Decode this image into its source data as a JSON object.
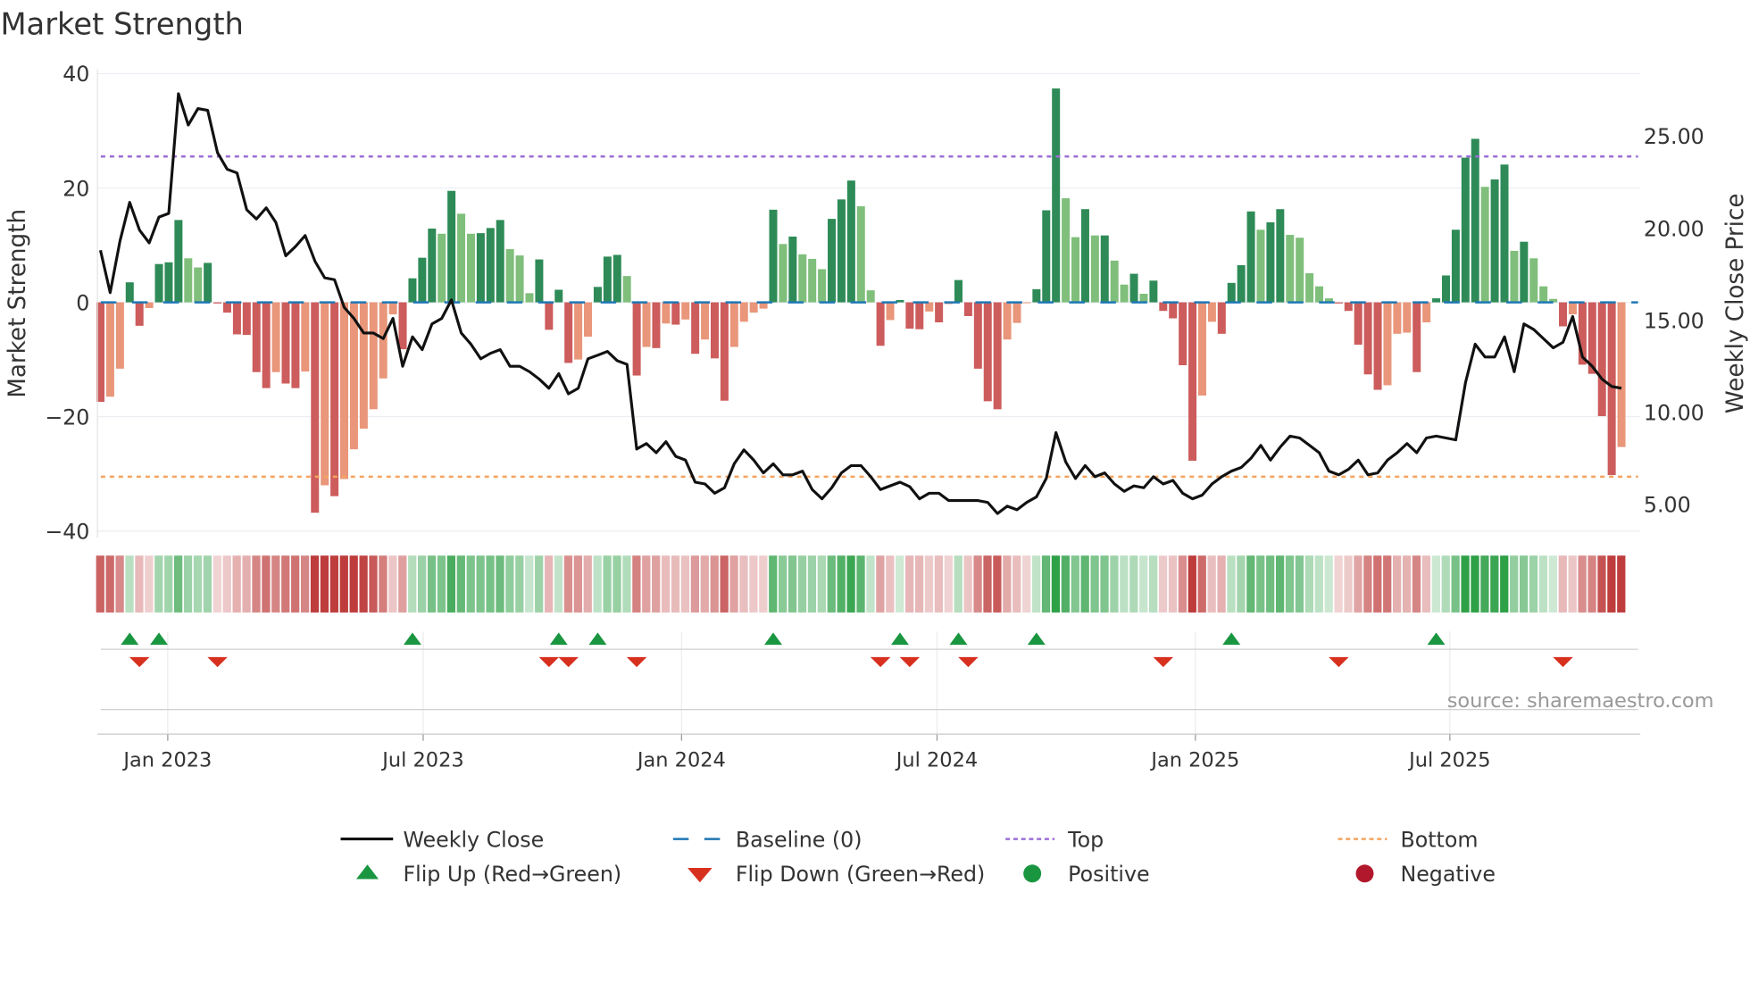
{
  "chart_data": {
    "type": "bar",
    "title": "Market Strength",
    "ylabel": "Market Strength",
    "y2label": "Weekly Close Price",
    "ylim": [
      -40,
      40
    ],
    "y2lim": [
      3.0,
      28.0
    ],
    "yticks": [
      "40",
      "20",
      "0",
      "−20",
      "−40"
    ],
    "ytick_values": [
      40,
      20,
      0,
      -20,
      -40
    ],
    "y2ticks": [
      "25.00",
      "20.00",
      "15.00",
      "10.00",
      "5.00"
    ],
    "y2tick_values": [
      25,
      20,
      15,
      10,
      5
    ],
    "xticks": [
      "Jan 2023",
      "Jul 2023",
      "Jan 2024",
      "Jul 2024",
      "Jan 2025",
      "Jul 2025"
    ],
    "xtick_week_index": [
      6.9,
      33.1,
      59.6,
      85.8,
      112.3,
      138.4
    ],
    "frequency": "weekly",
    "grid": true,
    "top_level": 25.5,
    "bottom_level": -30.5,
    "baseline": 0,
    "strength": [
      -17.4,
      -16.5,
      -11.6,
      3.5,
      -4.1,
      -1,
      6.7,
      7,
      14.4,
      7.7,
      6.1,
      6.9,
      -0.2,
      -1.8,
      -5.6,
      -5.7,
      -12.2,
      -15,
      -12.2,
      -14.2,
      -15,
      -12.1,
      -36.8,
      -32,
      -33.9,
      -30.9,
      -25.7,
      -22.1,
      -18.7,
      -13.3,
      -2.1,
      -8.2,
      4.2,
      7.8,
      12.9,
      12,
      19.5,
      15.5,
      12,
      12.1,
      13,
      14.4,
      9.3,
      8.2,
      1.6,
      7.5,
      -4.8,
      2.2,
      -10.6,
      -10,
      -6,
      2.7,
      8,
      8.3,
      4.6,
      -12.8,
      -7.8,
      -8,
      -3.7,
      -3.9,
      -3,
      -9,
      -6.5,
      -9.8,
      -17.2,
      -7.8,
      -3.4,
      -1.8,
      -1.1,
      16.2,
      10.2,
      11.5,
      8.4,
      7.6,
      5.8,
      14.6,
      18,
      21.3,
      16.8,
      2.1,
      -7.6,
      -3.1,
      0.4,
      -4.6,
      -4.7,
      -1.6,
      -3.5,
      -0.3,
      3.9,
      -2.4,
      -11.6,
      -17.3,
      -18.7,
      -6.5,
      -3.6,
      -0.1,
      2.3,
      16.1,
      37.4,
      18.2,
      11.4,
      16.3,
      11.7,
      11.7,
      7.3,
      3.1,
      5,
      1.5,
      3.8,
      -1.5,
      -2.8,
      -11,
      -27.7,
      -16.3,
      -3.4,
      -5.5,
      3.4,
      6.5,
      15.9,
      12.7,
      14,
      16.3,
      11.8,
      11.3,
      5.1,
      2.8,
      0.7,
      -0.2,
      -1.5,
      -7.4,
      -12.6,
      -15.3,
      -14.5,
      -5.5,
      -5.3,
      -12.2,
      -3.5,
      0.7,
      4.7,
      12.7,
      25.3,
      28.6,
      20.2,
      21.5,
      24.1,
      9,
      10.6,
      7.7,
      2.8,
      0.6,
      -4.2,
      -2.1,
      -10.9,
      -12.5,
      -19.9,
      -30.2,
      -25.3
    ],
    "weekly_close": [
      18.8,
      16.5,
      19.3,
      21.4,
      19.9,
      19.2,
      20.6,
      20.8,
      27.3,
      25.6,
      26.5,
      26.4,
      24.1,
      23.2,
      23,
      21,
      20.5,
      21.1,
      20.3,
      18.5,
      19,
      19.6,
      18.2,
      17.3,
      17.2,
      15.7,
      15.1,
      14.3,
      14.3,
      14,
      15.1,
      12.5,
      14.1,
      13.4,
      14.8,
      15.1,
      16.1,
      14.3,
      13.7,
      12.9,
      13.2,
      13.4,
      12.5,
      12.5,
      12.2,
      11.8,
      11.3,
      12.1,
      11,
      11.3,
      12.9,
      13.1,
      13.3,
      12.8,
      12.6,
      8,
      8.3,
      7.8,
      8.4,
      7.6,
      7.4,
      6.2,
      6.1,
      5.6,
      5.9,
      7.2,
      7.96,
      7.4,
      6.7,
      7.2,
      6.6,
      6.6,
      6.8,
      5.8,
      5.3,
      5.9,
      6.7,
      7.1,
      7.1,
      6.5,
      5.8,
      6,
      6.2,
      5.96,
      5.3,
      5.6,
      5.6,
      5.2,
      5.2,
      5.2,
      5.2,
      5.1,
      4.5,
      4.9,
      4.7,
      5.1,
      5.4,
      6.4,
      8.9,
      7.3,
      6.4,
      7.1,
      6.5,
      6.7,
      6.1,
      5.7,
      6,
      5.9,
      6.5,
      6.1,
      6.3,
      5.6,
      5.3,
      5.5,
      6.1,
      6.5,
      6.8,
      7,
      7.5,
      8.2,
      7.4,
      8.1,
      8.7,
      8.6,
      8.2,
      7.8,
      6.8,
      6.6,
      6.9,
      7.4,
      6.6,
      6.7,
      7.4,
      7.8,
      8.3,
      7.8,
      8.6,
      8.7,
      8.6,
      8.5,
      11.6,
      13.7,
      13,
      13,
      14.1,
      12.2,
      14.8,
      14.5,
      14,
      13.5,
      13.8,
      15.2,
      13,
      12.5,
      11.8,
      11.4,
      11.3
    ],
    "legend": {
      "placement": "bottom",
      "items": [
        {
          "label": "Weekly Close",
          "kind": "line"
        },
        {
          "label": "Baseline (0)",
          "kind": "dash"
        },
        {
          "label": "Top",
          "kind": "dot-purple"
        },
        {
          "label": "Bottom",
          "kind": "dot-orange"
        },
        {
          "label": "Flip Up (Red→Green)",
          "kind": "tri-up"
        },
        {
          "label": "Flip Down (Green→Red)",
          "kind": "tri-down"
        },
        {
          "label": "Positive",
          "kind": "circle-green"
        },
        {
          "label": "Negative",
          "kind": "circle-red"
        }
      ]
    },
    "source": "source: sharemaestro.com",
    "colors": {
      "pos_strong": "#2e8b57",
      "pos_weak": "#7fbf7b",
      "neg_strong": "#cd5c5c",
      "neg_weak": "#e9967a",
      "baseline": "#1f77b4",
      "top": "#9b6fd6",
      "bottom": "#f4a460",
      "line": "#111111",
      "flip_up": "#1a9641",
      "flip_down": "#d7301f",
      "positive": "#1a9641",
      "negative": "#b2182b"
    }
  }
}
